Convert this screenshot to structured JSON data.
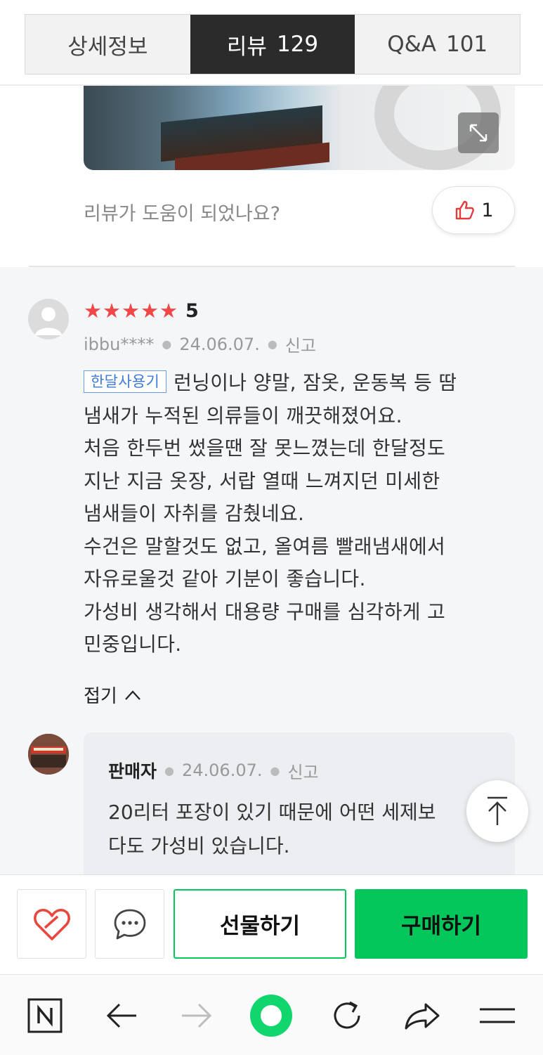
{
  "tabs": [
    {
      "label": "상세정보",
      "count": ""
    },
    {
      "label": "리뷰",
      "count": "129"
    },
    {
      "label": "Q&A",
      "count": "101"
    }
  ],
  "photo": {
    "expand_icon": "expand-icon"
  },
  "helpful": {
    "question": "리뷰가 도움이 되었나요?",
    "like_count": "1",
    "icon": "thumbs-up-icon"
  },
  "review": {
    "rating": "5",
    "stars": [
      "★",
      "★",
      "★",
      "★",
      "★"
    ],
    "author": "ibbu****",
    "date": "24.06.07.",
    "report_label": "신고",
    "badge": "한달사용기",
    "lines": [
      "런닝이나 양말, 잠옷, 운동복 등 땀",
      "냄새가 누적된 의류들이 깨끗해졌어요.",
      "처음 한두번 썼을땐 잘 못느꼈는데 한달정도",
      "지난 지금 옷장, 서랍 열때 느껴지던 미세한",
      "냄새들이 자취를 감췄네요.",
      "수건은 말할것도 없고, 올여름 빨래냄새에서",
      "자유로울것 같아 기분이 좋습니다.",
      "가성비 생각해서 대용량 구매를 심각하게 고",
      "민중입니다."
    ],
    "fold_label": "접기"
  },
  "reply": {
    "author": "판매자",
    "date": "24.06.07.",
    "report_label": "신고",
    "lines": [
      "20리터 포장이 있기 때문에 어떤 세제보",
      "다도 가성비 있습니다."
    ]
  },
  "purchase_bar": {
    "gift_label": "선물하기",
    "buy_label": "구매하기",
    "accent_color": "#03c75a"
  },
  "browser_nav": [
    "naver-home-icon",
    "back-arrow-icon",
    "forward-arrow-icon",
    "green-dot-home-icon",
    "refresh-icon",
    "share-icon",
    "menu-icon"
  ]
}
